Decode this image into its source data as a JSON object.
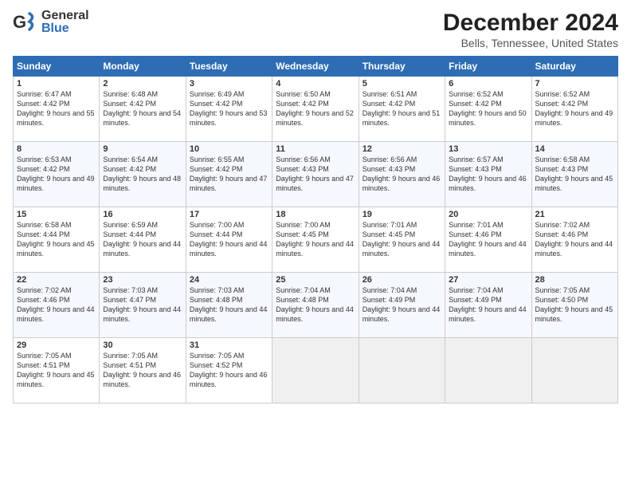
{
  "header": {
    "logo_general": "General",
    "logo_blue": "Blue",
    "main_title": "December 2024",
    "sub_title": "Bells, Tennessee, United States"
  },
  "weekdays": [
    "Sunday",
    "Monday",
    "Tuesday",
    "Wednesday",
    "Thursday",
    "Friday",
    "Saturday"
  ],
  "weeks": [
    [
      {
        "day": 1,
        "sunrise": "6:47 AM",
        "sunset": "4:42 PM",
        "daylight": "9 hours and 55 minutes."
      },
      {
        "day": 2,
        "sunrise": "6:48 AM",
        "sunset": "4:42 PM",
        "daylight": "9 hours and 54 minutes."
      },
      {
        "day": 3,
        "sunrise": "6:49 AM",
        "sunset": "4:42 PM",
        "daylight": "9 hours and 53 minutes."
      },
      {
        "day": 4,
        "sunrise": "6:50 AM",
        "sunset": "4:42 PM",
        "daylight": "9 hours and 52 minutes."
      },
      {
        "day": 5,
        "sunrise": "6:51 AM",
        "sunset": "4:42 PM",
        "daylight": "9 hours and 51 minutes."
      },
      {
        "day": 6,
        "sunrise": "6:52 AM",
        "sunset": "4:42 PM",
        "daylight": "9 hours and 50 minutes."
      },
      {
        "day": 7,
        "sunrise": "6:52 AM",
        "sunset": "4:42 PM",
        "daylight": "9 hours and 49 minutes."
      }
    ],
    [
      {
        "day": 8,
        "sunrise": "6:53 AM",
        "sunset": "4:42 PM",
        "daylight": "9 hours and 49 minutes."
      },
      {
        "day": 9,
        "sunrise": "6:54 AM",
        "sunset": "4:42 PM",
        "daylight": "9 hours and 48 minutes."
      },
      {
        "day": 10,
        "sunrise": "6:55 AM",
        "sunset": "4:42 PM",
        "daylight": "9 hours and 47 minutes."
      },
      {
        "day": 11,
        "sunrise": "6:56 AM",
        "sunset": "4:43 PM",
        "daylight": "9 hours and 47 minutes."
      },
      {
        "day": 12,
        "sunrise": "6:56 AM",
        "sunset": "4:43 PM",
        "daylight": "9 hours and 46 minutes."
      },
      {
        "day": 13,
        "sunrise": "6:57 AM",
        "sunset": "4:43 PM",
        "daylight": "9 hours and 46 minutes."
      },
      {
        "day": 14,
        "sunrise": "6:58 AM",
        "sunset": "4:43 PM",
        "daylight": "9 hours and 45 minutes."
      }
    ],
    [
      {
        "day": 15,
        "sunrise": "6:58 AM",
        "sunset": "4:44 PM",
        "daylight": "9 hours and 45 minutes."
      },
      {
        "day": 16,
        "sunrise": "6:59 AM",
        "sunset": "4:44 PM",
        "daylight": "9 hours and 44 minutes."
      },
      {
        "day": 17,
        "sunrise": "7:00 AM",
        "sunset": "4:44 PM",
        "daylight": "9 hours and 44 minutes."
      },
      {
        "day": 18,
        "sunrise": "7:00 AM",
        "sunset": "4:45 PM",
        "daylight": "9 hours and 44 minutes."
      },
      {
        "day": 19,
        "sunrise": "7:01 AM",
        "sunset": "4:45 PM",
        "daylight": "9 hours and 44 minutes."
      },
      {
        "day": 20,
        "sunrise": "7:01 AM",
        "sunset": "4:46 PM",
        "daylight": "9 hours and 44 minutes."
      },
      {
        "day": 21,
        "sunrise": "7:02 AM",
        "sunset": "4:46 PM",
        "daylight": "9 hours and 44 minutes."
      }
    ],
    [
      {
        "day": 22,
        "sunrise": "7:02 AM",
        "sunset": "4:46 PM",
        "daylight": "9 hours and 44 minutes."
      },
      {
        "day": 23,
        "sunrise": "7:03 AM",
        "sunset": "4:47 PM",
        "daylight": "9 hours and 44 minutes."
      },
      {
        "day": 24,
        "sunrise": "7:03 AM",
        "sunset": "4:48 PM",
        "daylight": "9 hours and 44 minutes."
      },
      {
        "day": 25,
        "sunrise": "7:04 AM",
        "sunset": "4:48 PM",
        "daylight": "9 hours and 44 minutes."
      },
      {
        "day": 26,
        "sunrise": "7:04 AM",
        "sunset": "4:49 PM",
        "daylight": "9 hours and 44 minutes."
      },
      {
        "day": 27,
        "sunrise": "7:04 AM",
        "sunset": "4:49 PM",
        "daylight": "9 hours and 44 minutes."
      },
      {
        "day": 28,
        "sunrise": "7:05 AM",
        "sunset": "4:50 PM",
        "daylight": "9 hours and 45 minutes."
      }
    ],
    [
      {
        "day": 29,
        "sunrise": "7:05 AM",
        "sunset": "4:51 PM",
        "daylight": "9 hours and 45 minutes."
      },
      {
        "day": 30,
        "sunrise": "7:05 AM",
        "sunset": "4:51 PM",
        "daylight": "9 hours and 46 minutes."
      },
      {
        "day": 31,
        "sunrise": "7:05 AM",
        "sunset": "4:52 PM",
        "daylight": "9 hours and 46 minutes."
      },
      null,
      null,
      null,
      null
    ]
  ],
  "labels": {
    "sunrise": "Sunrise:",
    "sunset": "Sunset:",
    "daylight": "Daylight:"
  }
}
